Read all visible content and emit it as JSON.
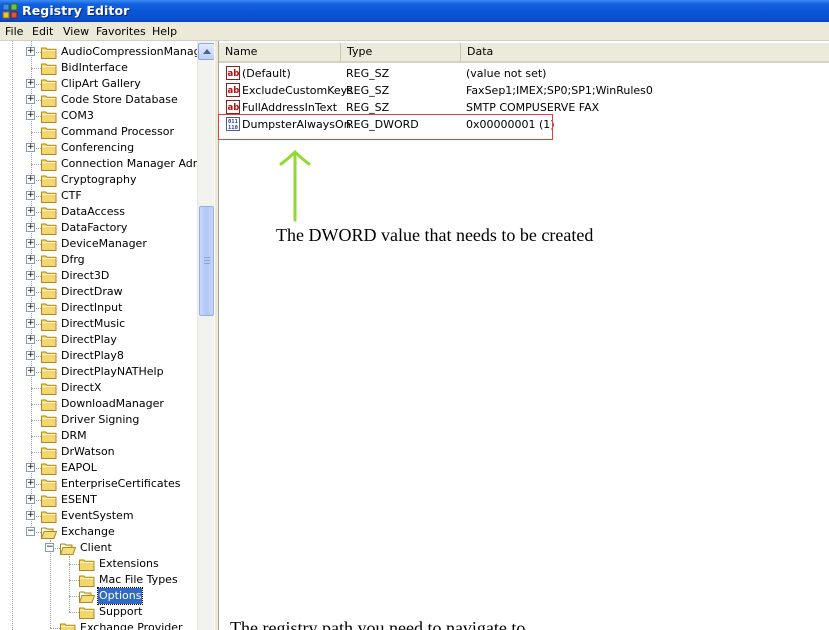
{
  "window": {
    "title": "Registry Editor"
  },
  "menu": [
    "File",
    "Edit",
    "View",
    "Favorites",
    "Help"
  ],
  "tree": {
    "items": [
      {
        "label": "AudioCompressionManager",
        "level": 1,
        "expandable": true
      },
      {
        "label": "BidInterface",
        "level": 1,
        "expandable": false
      },
      {
        "label": "ClipArt Gallery",
        "level": 1,
        "expandable": true
      },
      {
        "label": "Code Store Database",
        "level": 1,
        "expandable": true
      },
      {
        "label": "COM3",
        "level": 1,
        "expandable": true
      },
      {
        "label": "Command Processor",
        "level": 1,
        "expandable": false
      },
      {
        "label": "Conferencing",
        "level": 1,
        "expandable": true
      },
      {
        "label": "Connection Manager Adminis",
        "level": 1,
        "expandable": false
      },
      {
        "label": "Cryptography",
        "level": 1,
        "expandable": true
      },
      {
        "label": "CTF",
        "level": 1,
        "expandable": true
      },
      {
        "label": "DataAccess",
        "level": 1,
        "expandable": true
      },
      {
        "label": "DataFactory",
        "level": 1,
        "expandable": true
      },
      {
        "label": "DeviceManager",
        "level": 1,
        "expandable": true
      },
      {
        "label": "Dfrg",
        "level": 1,
        "expandable": true
      },
      {
        "label": "Direct3D",
        "level": 1,
        "expandable": true
      },
      {
        "label": "DirectDraw",
        "level": 1,
        "expandable": true
      },
      {
        "label": "DirectInput",
        "level": 1,
        "expandable": true
      },
      {
        "label": "DirectMusic",
        "level": 1,
        "expandable": true
      },
      {
        "label": "DirectPlay",
        "level": 1,
        "expandable": true
      },
      {
        "label": "DirectPlay8",
        "level": 1,
        "expandable": true
      },
      {
        "label": "DirectPlayNATHelp",
        "level": 1,
        "expandable": true
      },
      {
        "label": "DirectX",
        "level": 1,
        "expandable": false
      },
      {
        "label": "DownloadManager",
        "level": 1,
        "expandable": false
      },
      {
        "label": "Driver Signing",
        "level": 1,
        "expandable": false
      },
      {
        "label": "DRM",
        "level": 1,
        "expandable": false
      },
      {
        "label": "DrWatson",
        "level": 1,
        "expandable": false
      },
      {
        "label": "EAPOL",
        "level": 1,
        "expandable": true
      },
      {
        "label": "EnterpriseCertificates",
        "level": 1,
        "expandable": true
      },
      {
        "label": "ESENT",
        "level": 1,
        "expandable": true
      },
      {
        "label": "EventSystem",
        "level": 1,
        "expandable": true
      },
      {
        "label": "Exchange",
        "level": 1,
        "expandable": true,
        "expanded": true
      },
      {
        "label": "Client",
        "level": 2,
        "expandable": true,
        "expanded": true
      },
      {
        "label": "Extensions",
        "level": 3,
        "expandable": false
      },
      {
        "label": "Mac File Types",
        "level": 3,
        "expandable": false
      },
      {
        "label": "Options",
        "level": 3,
        "expandable": false,
        "selected": true
      },
      {
        "label": "Support",
        "level": 3,
        "expandable": false
      },
      {
        "label": "Exchange Provider",
        "level": 2,
        "expandable": false
      }
    ]
  },
  "list": {
    "columns": [
      "Name",
      "Type",
      "Data"
    ],
    "rows": [
      {
        "name": "(Default)",
        "type": "REG_SZ",
        "data": "(value not set)",
        "icon": "string-value-icon"
      },
      {
        "name": "ExcludeCustomKeys",
        "type": "REG_SZ",
        "data": "FaxSep1;IMEX;SP0;SP1;WinRules0",
        "icon": "string-value-icon"
      },
      {
        "name": "FullAddressInText",
        "type": "REG_SZ",
        "data": "SMTP COMPUSERVE FAX",
        "icon": "string-value-icon"
      },
      {
        "name": "DumpsterAlwaysOn",
        "type": "REG_DWORD",
        "data": "0x00000001 (1)",
        "icon": "binary-value-icon"
      }
    ]
  },
  "annotations": {
    "dword_note": "The DWORD value that needs to be created",
    "path_note": "The registry path you need to navigate to",
    "box_color": "#e0413f",
    "arrow_color": "#8edb2e"
  }
}
